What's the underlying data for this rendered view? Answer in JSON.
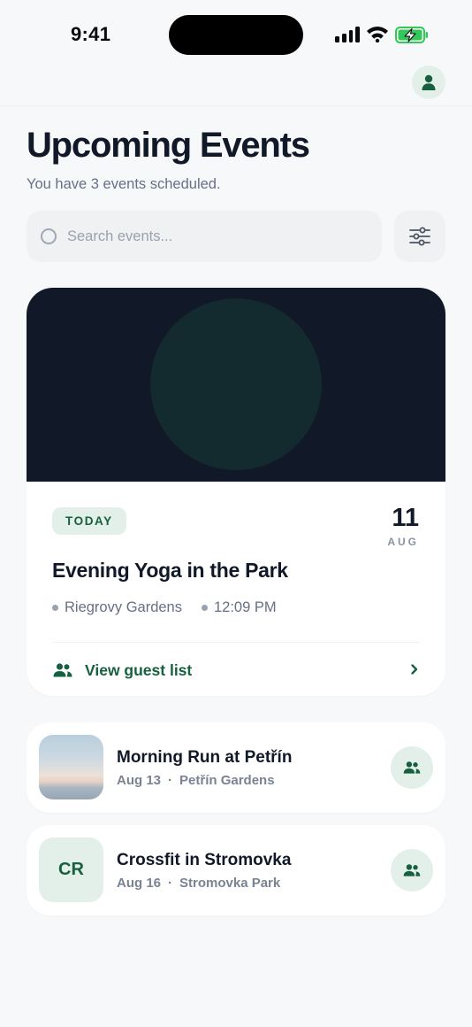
{
  "status_bar": {
    "time": "9:41"
  },
  "header": {
    "title": "Upcoming Events",
    "subtitle": "You have 3 events scheduled."
  },
  "search": {
    "placeholder": "Search events..."
  },
  "featured": {
    "badge": "TODAY",
    "day": "11",
    "month": "AUG",
    "title": "Evening Yoga in the Park",
    "location": "Riegrovy Gardens",
    "time": "12:09 PM",
    "guest_link": "View guest list"
  },
  "events": [
    {
      "title": "Morning Run at Petřín",
      "date": "Aug 13",
      "separator": "·",
      "location": "Petřín Gardens",
      "thumb": "photo"
    },
    {
      "title": "Crossfit in Stromovka",
      "date": "Aug 16",
      "separator": "·",
      "location": "Stromovka Park",
      "initials": "CR"
    }
  ],
  "colors": {
    "accent": "#17603f",
    "accent_bg": "#e3efe9",
    "dark": "#111827",
    "muted": "#667085",
    "background": "#f7f8fa"
  },
  "icons": {
    "profile": "user-icon",
    "filter": "sliders-icon",
    "guests": "users-icon",
    "chevron": "chevron-right-icon"
  }
}
